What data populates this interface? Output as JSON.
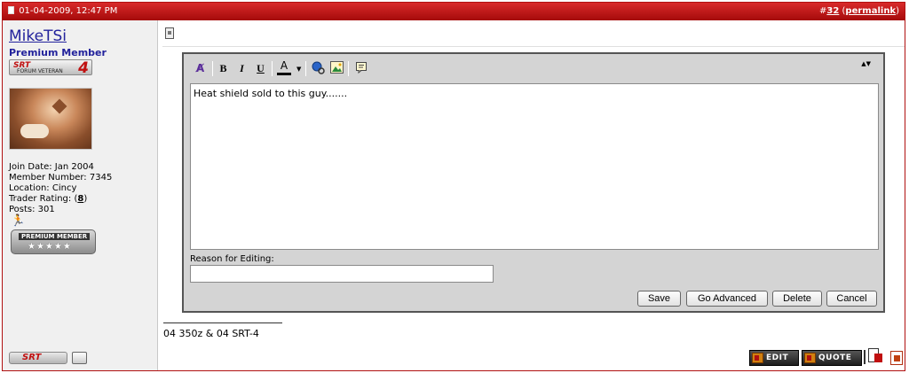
{
  "header": {
    "datetime": "01-04-2009, 12:47 PM",
    "post_number_prefix": "#",
    "post_number": "32",
    "permalink_label": "permalink"
  },
  "user": {
    "name": "MikeTSi",
    "title": "Premium Member",
    "badge_veteran_text": "SRT",
    "badge_veteran_sub": "FORUM VETERAN",
    "badge_veteran_num": "4",
    "stats": {
      "join_date": "Join Date: Jan 2004",
      "member_number": "Member Number: 7345",
      "location": "Location: Cincy",
      "trader_rating_label": "Trader Rating: (",
      "trader_rating_value": "8",
      "trader_rating_close": ")",
      "posts": "Posts: 301"
    },
    "premium_badge_text": "PREMIUM MEMBER",
    "premium_stars": "★★★★★",
    "srt_logo_text": "SRT"
  },
  "editor": {
    "toolbar": {
      "remove_format": "A̸",
      "bold": "B",
      "italic": "I",
      "underline": "U",
      "font_color": "A",
      "dropdown_arrow": "▼",
      "expand": "▲▼"
    },
    "message": "Heat shield sold to this guy.......",
    "reason_label": "Reason for Editing:",
    "reason_value": "",
    "buttons": {
      "save": "Save",
      "go_advanced": "Go Advanced",
      "delete": "Delete",
      "cancel": "Cancel"
    }
  },
  "signature": "04 350z & 04 SRT-4",
  "actions": {
    "edit": "EDIT",
    "quote": "QUOTE"
  }
}
